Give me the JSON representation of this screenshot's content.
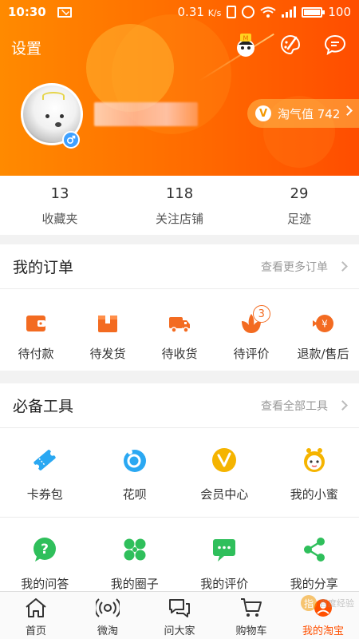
{
  "status_bar": {
    "time": "10:30",
    "speed": "0.31",
    "speed_unit": "K/s",
    "battery": "100"
  },
  "header": {
    "settings_label": "设置",
    "vip_label": "淘气值 742",
    "vip_badge": "V"
  },
  "stats": [
    {
      "num": "13",
      "label": "收藏夹"
    },
    {
      "num": "118",
      "label": "关注店铺"
    },
    {
      "num": "29",
      "label": "足迹"
    }
  ],
  "orders": {
    "title": "我的订单",
    "more": "查看更多订单",
    "items": [
      {
        "label": "待付款",
        "icon": "wallet-icon"
      },
      {
        "label": "待发货",
        "icon": "package-icon"
      },
      {
        "label": "待收货",
        "icon": "truck-icon"
      },
      {
        "label": "待评价",
        "icon": "review-icon",
        "badge": "3"
      },
      {
        "label": "退款/售后",
        "icon": "refund-icon"
      }
    ]
  },
  "tools": {
    "title": "必备工具",
    "more": "查看全部工具",
    "row1": [
      {
        "label": "卡券包",
        "icon": "coupon-icon"
      },
      {
        "label": "花呗",
        "icon": "huabei-icon"
      },
      {
        "label": "会员中心",
        "icon": "member-icon"
      },
      {
        "label": "我的小蜜",
        "icon": "assistant-icon"
      }
    ],
    "row2": [
      {
        "label": "我的问答",
        "icon": "question-icon"
      },
      {
        "label": "我的圈子",
        "icon": "circle-icon"
      },
      {
        "label": "我的评价",
        "icon": "comment-icon"
      },
      {
        "label": "我的分享",
        "icon": "share-icon"
      }
    ]
  },
  "tabbar": [
    {
      "label": "首页",
      "icon": "home-icon"
    },
    {
      "label": "微淘",
      "icon": "broadcast-icon"
    },
    {
      "label": "问大家",
      "icon": "chat-icon"
    },
    {
      "label": "购物车",
      "icon": "cart-icon"
    },
    {
      "label": "我的淘宝",
      "icon": "profile-icon",
      "active": true
    }
  ],
  "watermark": {
    "badge": "指",
    "text": "百度经验"
  },
  "colors": {
    "accent": "#ff5000",
    "header_start": "#ff8a00",
    "header_end": "#ff4d00",
    "order_icon": "#f36b21",
    "tool_blue": "#2aa8f2",
    "tool_yellow": "#f5b400",
    "tool_green": "#2fbf5b",
    "gender_blue": "#3ea0ff"
  }
}
